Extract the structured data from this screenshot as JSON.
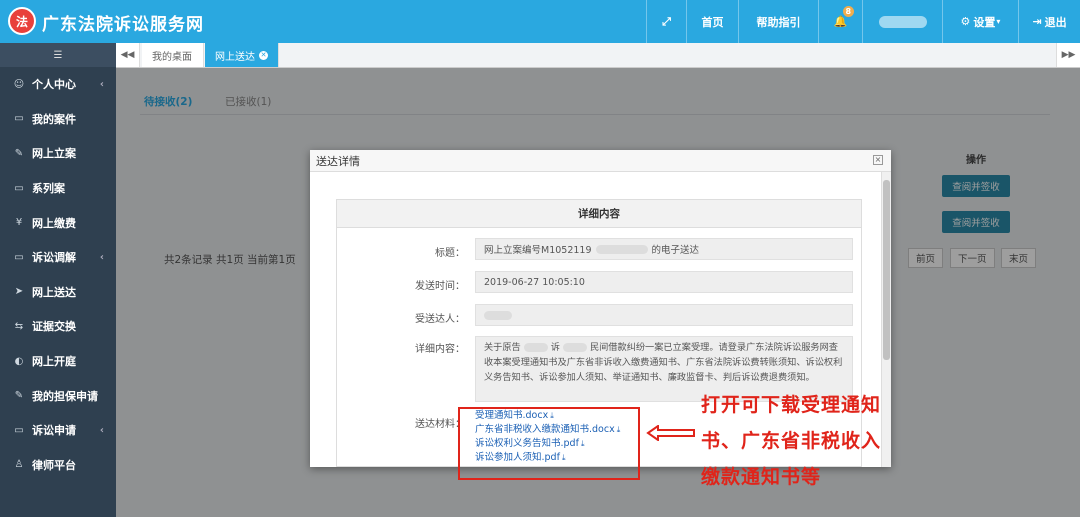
{
  "header": {
    "logo_text": "法",
    "brand": "广东法院诉讼服务网",
    "nav": {
      "expand_icon": "expand-icon",
      "home": "首页",
      "help": "帮助指引",
      "notifications_count": "8",
      "settings": "设置",
      "logout": "退出"
    }
  },
  "sidebar": {
    "toggle": "☰",
    "items": [
      {
        "label": "个人中心",
        "icon": "☺",
        "has_children": true
      },
      {
        "label": "我的案件",
        "icon": "▭",
        "has_children": false
      },
      {
        "label": "网上立案",
        "icon": "✎",
        "has_children": false
      },
      {
        "label": "系列案",
        "icon": "▭",
        "has_children": false
      },
      {
        "label": "网上缴费",
        "icon": "¥",
        "has_children": false
      },
      {
        "label": "诉讼调解",
        "icon": "▭",
        "has_children": true
      },
      {
        "label": "网上送达",
        "icon": "➤",
        "has_children": false
      },
      {
        "label": "证据交换",
        "icon": "⇆",
        "has_children": false
      },
      {
        "label": "网上开庭",
        "icon": "◐",
        "has_children": false
      },
      {
        "label": "我的担保申请",
        "icon": "✎",
        "has_children": false
      },
      {
        "label": "诉讼申请",
        "icon": "▭",
        "has_children": true
      },
      {
        "label": "律师平台",
        "icon": "♙",
        "has_children": false
      }
    ]
  },
  "tabs": {
    "items": [
      {
        "label": "我的桌面",
        "active": false
      },
      {
        "label": "网上送达",
        "active": true
      }
    ]
  },
  "content": {
    "subtabs": [
      {
        "label": "待接收(2)",
        "active": true
      },
      {
        "label": "已接收(1)",
        "active": false
      }
    ],
    "op_header": "操作",
    "row_button": "查阅并签收",
    "pager_text": "共2条记录 共1页 当前第1页",
    "pager_buttons": [
      "前页",
      "下一页",
      "末页"
    ]
  },
  "modal": {
    "title": "送达详情",
    "close": "×",
    "panel_title": "详细内容",
    "fields": {
      "subject_label": "标题：",
      "subject_prefix": "网上立案编号M1052119",
      "subject_suffix": "的电子送达",
      "time_label": "发送时间：",
      "time_value": "2019-06-27 10:05:10",
      "recipient_label": "受送达人：",
      "detail_label": "详细内容：",
      "detail_p1": "关于原告",
      "detail_p2": "诉",
      "detail_p3": "民间借款纠纷一案已立案受理。请登录广东法院诉讼服务网查收本案受理通知书及广东省非诉收入缴费通知书、广东省法院诉讼费转账须知、诉讼权利义务告知书、诉讼参加人须知、举证通知书、廉政监督卡、判后诉讼费退费须知。",
      "files_label": "送达材料："
    },
    "files": [
      "受理通知书.docx",
      "广东省非税收入缴款通知书.docx",
      "诉讼权利义务告知书.pdf",
      "诉讼参加人须知.pdf"
    ]
  },
  "annotation": {
    "note": "打开可下载受理通知书、广东省非税收入缴款通知书等"
  }
}
